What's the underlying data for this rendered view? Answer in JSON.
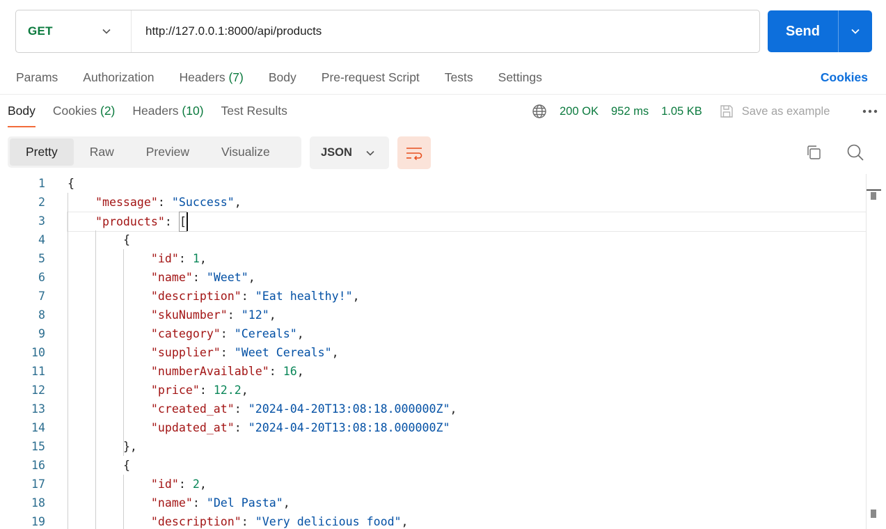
{
  "request": {
    "method": "GET",
    "url": "http://127.0.0.1:8000/api/products",
    "send_label": "Send"
  },
  "request_tabs": {
    "params": "Params",
    "authorization": "Authorization",
    "headers": "Headers",
    "headers_count": "(7)",
    "body": "Body",
    "pre_request_script": "Pre-request Script",
    "tests": "Tests",
    "settings": "Settings",
    "cookies": "Cookies"
  },
  "response_tabs": {
    "body": "Body",
    "cookies": "Cookies",
    "cookies_count": "(2)",
    "headers": "Headers",
    "headers_count": "(10)",
    "test_results": "Test Results"
  },
  "response_status": {
    "status": "200 OK",
    "time": "952 ms",
    "size": "1.05 KB",
    "save_example": "Save as example"
  },
  "view_modes": {
    "pretty": "Pretty",
    "raw": "Raw",
    "preview": "Preview",
    "visualize": "Visualize",
    "format": "JSON"
  },
  "code_lines": [
    {
      "n": "1",
      "indent": 0,
      "parts": [
        [
          "p",
          "{"
        ]
      ]
    },
    {
      "n": "2",
      "indent": 1,
      "parts": [
        [
          "k",
          "\"message\""
        ],
        [
          "p",
          ": "
        ],
        [
          "s",
          "\"Success\""
        ],
        [
          "p",
          ","
        ]
      ]
    },
    {
      "n": "3",
      "indent": 1,
      "parts": [
        [
          "k",
          "\"products\""
        ],
        [
          "p",
          ": "
        ],
        [
          "c",
          "["
        ]
      ]
    },
    {
      "n": "4",
      "indent": 2,
      "parts": [
        [
          "p",
          "{"
        ]
      ]
    },
    {
      "n": "5",
      "indent": 3,
      "parts": [
        [
          "k",
          "\"id\""
        ],
        [
          "p",
          ": "
        ],
        [
          "n",
          "1"
        ],
        [
          "p",
          ","
        ]
      ]
    },
    {
      "n": "6",
      "indent": 3,
      "parts": [
        [
          "k",
          "\"name\""
        ],
        [
          "p",
          ": "
        ],
        [
          "s",
          "\"Weet\""
        ],
        [
          "p",
          ","
        ]
      ]
    },
    {
      "n": "7",
      "indent": 3,
      "parts": [
        [
          "k",
          "\"description\""
        ],
        [
          "p",
          ": "
        ],
        [
          "s",
          "\"Eat healthy!\""
        ],
        [
          "p",
          ","
        ]
      ]
    },
    {
      "n": "8",
      "indent": 3,
      "parts": [
        [
          "k",
          "\"skuNumber\""
        ],
        [
          "p",
          ": "
        ],
        [
          "s",
          "\"12\""
        ],
        [
          "p",
          ","
        ]
      ]
    },
    {
      "n": "9",
      "indent": 3,
      "parts": [
        [
          "k",
          "\"category\""
        ],
        [
          "p",
          ": "
        ],
        [
          "s",
          "\"Cereals\""
        ],
        [
          "p",
          ","
        ]
      ]
    },
    {
      "n": "10",
      "indent": 3,
      "parts": [
        [
          "k",
          "\"supplier\""
        ],
        [
          "p",
          ": "
        ],
        [
          "s",
          "\"Weet Cereals\""
        ],
        [
          "p",
          ","
        ]
      ]
    },
    {
      "n": "11",
      "indent": 3,
      "parts": [
        [
          "k",
          "\"numberAvailable\""
        ],
        [
          "p",
          ": "
        ],
        [
          "n",
          "16"
        ],
        [
          "p",
          ","
        ]
      ]
    },
    {
      "n": "12",
      "indent": 3,
      "parts": [
        [
          "k",
          "\"price\""
        ],
        [
          "p",
          ": "
        ],
        [
          "n",
          "12.2"
        ],
        [
          "p",
          ","
        ]
      ]
    },
    {
      "n": "13",
      "indent": 3,
      "parts": [
        [
          "k",
          "\"created_at\""
        ],
        [
          "p",
          ": "
        ],
        [
          "s",
          "\"2024-04-20T13:08:18.000000Z\""
        ],
        [
          "p",
          ","
        ]
      ]
    },
    {
      "n": "14",
      "indent": 3,
      "parts": [
        [
          "k",
          "\"updated_at\""
        ],
        [
          "p",
          ": "
        ],
        [
          "s",
          "\"2024-04-20T13:08:18.000000Z\""
        ]
      ]
    },
    {
      "n": "15",
      "indent": 2,
      "parts": [
        [
          "p",
          "},"
        ]
      ]
    },
    {
      "n": "16",
      "indent": 2,
      "parts": [
        [
          "p",
          "{"
        ]
      ]
    },
    {
      "n": "17",
      "indent": 3,
      "parts": [
        [
          "k",
          "\"id\""
        ],
        [
          "p",
          ": "
        ],
        [
          "n",
          "2"
        ],
        [
          "p",
          ","
        ]
      ]
    },
    {
      "n": "18",
      "indent": 3,
      "parts": [
        [
          "k",
          "\"name\""
        ],
        [
          "p",
          ": "
        ],
        [
          "s",
          "\"Del Pasta\""
        ],
        [
          "p",
          ","
        ]
      ]
    },
    {
      "n": "19",
      "indent": 3,
      "parts": [
        [
          "k",
          "\"description\""
        ],
        [
          "p",
          ": "
        ],
        [
          "s",
          "\"Very delicious food\""
        ],
        [
          "p",
          ","
        ]
      ]
    }
  ],
  "icons": {
    "method_dropdown": "chevron-down-icon",
    "send_dropdown": "chevron-down-icon",
    "network": "globe-icon",
    "save": "save-icon",
    "more": "more-horizontal-icon",
    "format_dropdown": "chevron-down-icon",
    "wrap": "wrap-lines-icon",
    "copy": "copy-icon",
    "search": "search-icon"
  },
  "colors": {
    "accent": "#0d6fdc",
    "success": "#0b7a3e",
    "active_tab_underline": "#f26b3a",
    "json_key": "#a31515",
    "json_string": "#0451a5",
    "json_number": "#098658"
  }
}
